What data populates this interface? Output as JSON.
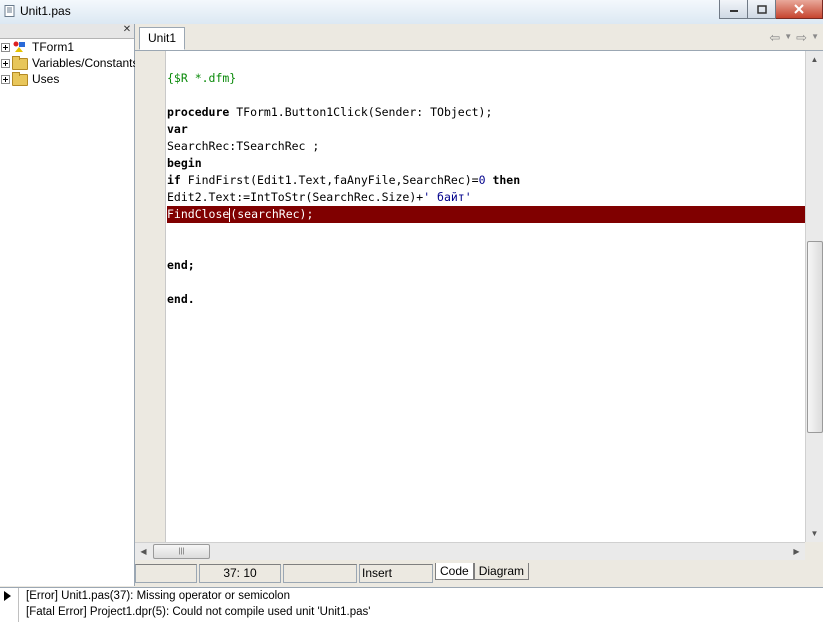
{
  "window": {
    "title": "Unit1.pas"
  },
  "tree": {
    "items": [
      {
        "label": "TForm1"
      },
      {
        "label": "Variables/Constants"
      },
      {
        "label": "Uses"
      }
    ]
  },
  "editor": {
    "tab": "Unit1",
    "lines": {
      "l1": "{$R *.dfm}",
      "l3_kw": "procedure",
      "l3_rest": " TForm1.Button1Click(Sender: TObject);",
      "l4": "var",
      "l5": "SearchRec:TSearchRec ;",
      "l6": "begin",
      "l7_kw": "if",
      "l7_a": " FindFirst(Edit1.Text,faAnyFile,SearchRec)=",
      "l7_num": "0",
      "l7_sp": " ",
      "l7_then": "then",
      "l8_a": "Edit2.Text:=IntToStr(SearchRec.Size)+",
      "l8_str": "' байт'",
      "l9_a": "FindClose",
      "l9_b": "(searchRec);",
      "l12": "end;",
      "l14": "end."
    }
  },
  "statusbar": {
    "position": "37:  10",
    "mode": "Insert",
    "view_tabs": [
      "Code",
      "Diagram"
    ]
  },
  "messages": [
    "[Error] Unit1.pas(37): Missing operator or semicolon",
    "[Fatal Error] Project1.dpr(5): Could not compile used unit 'Unit1.pas'"
  ]
}
